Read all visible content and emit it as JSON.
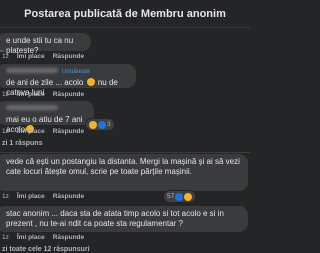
{
  "header": {
    "title": "Postarea publicată de Membru anonim"
  },
  "actions": {
    "like": "Îmi place",
    "reply": "Răspunde"
  },
  "comments": [
    {
      "text": "e unde stii tu ca nu plateste?",
      "time": "1z"
    },
    {
      "tag": "Urmărește",
      "text_a": "de ani de zile ... acolo",
      "text_b": "nu de cateva luni",
      "time": "1z"
    },
    {
      "text": "mai eu o atiu de 7 ani acolo",
      "time": "1z",
      "reaction_count": "3"
    },
    {
      "replies": "zi 1 răspuns"
    },
    {
      "text": "vede că ești un postangiu la distanta. Mergi la mașină și ai să vezi cate locuri ătește omul, scrie pe toate părțile mașinii.",
      "time": "1z",
      "reaction_count": "57"
    },
    {
      "text": "stac anonim ... daca sta de atata timp acolo si tot acolo e si in prezent , nu te-ai ndit ca poate sta regulamentar ?",
      "time": "1z"
    },
    {
      "replies": "zi toate cele 12 răspunsuri"
    }
  ]
}
